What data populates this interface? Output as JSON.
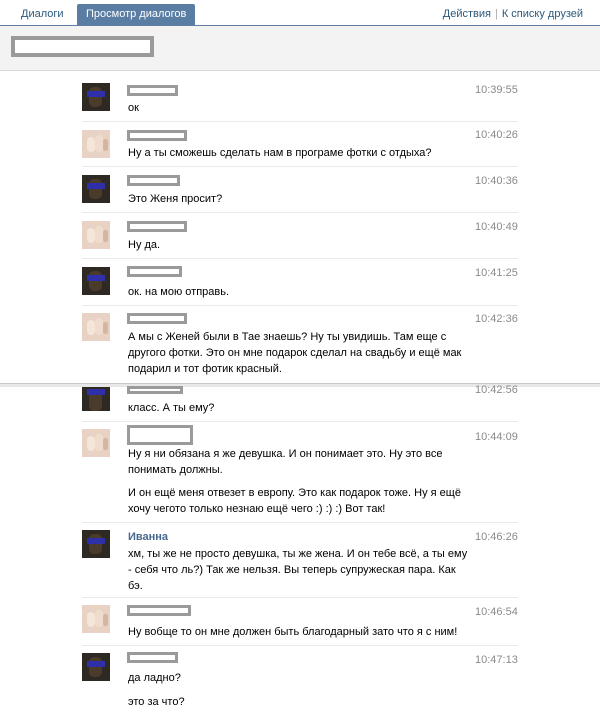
{
  "tabs": {
    "dialogs": "Диалоги",
    "view_dialogs": "Просмотр диалогов"
  },
  "links": {
    "actions": "Действия",
    "separator": "|",
    "to_friends": "К списку друзей"
  },
  "messages": [
    {
      "time": "10:39:55",
      "text": "ок"
    },
    {
      "time": "10:40:26",
      "text": "Ну а ты сможешь сделать нам в програме фотки с отдыха?"
    },
    {
      "time": "10:40:36",
      "text": "Это Женя просит?"
    },
    {
      "time": "10:40:49",
      "text": "Ну да."
    },
    {
      "time": "10:41:25",
      "text": "ок. на мою отправь."
    },
    {
      "time": "10:42:36",
      "text": "А мы с Женей были в Тае знаешь? Ну ты увидишь. Там еще с другого фотки. Это он мне подарок сделал на свадьбу и ещё мак подарил и тот фотик красный."
    },
    {
      "time": "10:42:56",
      "text": "класс. А ты ему?"
    },
    {
      "time": "10:44:09",
      "text": "Ну я ни обязана я же девушка. И он понимает это. Ну это все понимать должны.",
      "text2": "И он ещё меня отвезет в европу. Это как подарок тоже. Ну я ещё хочу чегото только незнаю ещё чего :) :) :) Вот так!"
    },
    {
      "time": "10:46:26",
      "sender": "Иванна",
      "text": "хм, ты же не просто девушка, ты же жена. И он тебе всё, а ты ему - себя что ль?) Так же нельзя. Вы теперь супружеская пара. Как бэ."
    },
    {
      "time": "10:46:54",
      "text": "Ну вобще то он мне должен быть благодарный зато что я с ним!"
    },
    {
      "time": "10:47:13",
      "text": "да ладно?",
      "text2": "это за что?"
    }
  ]
}
